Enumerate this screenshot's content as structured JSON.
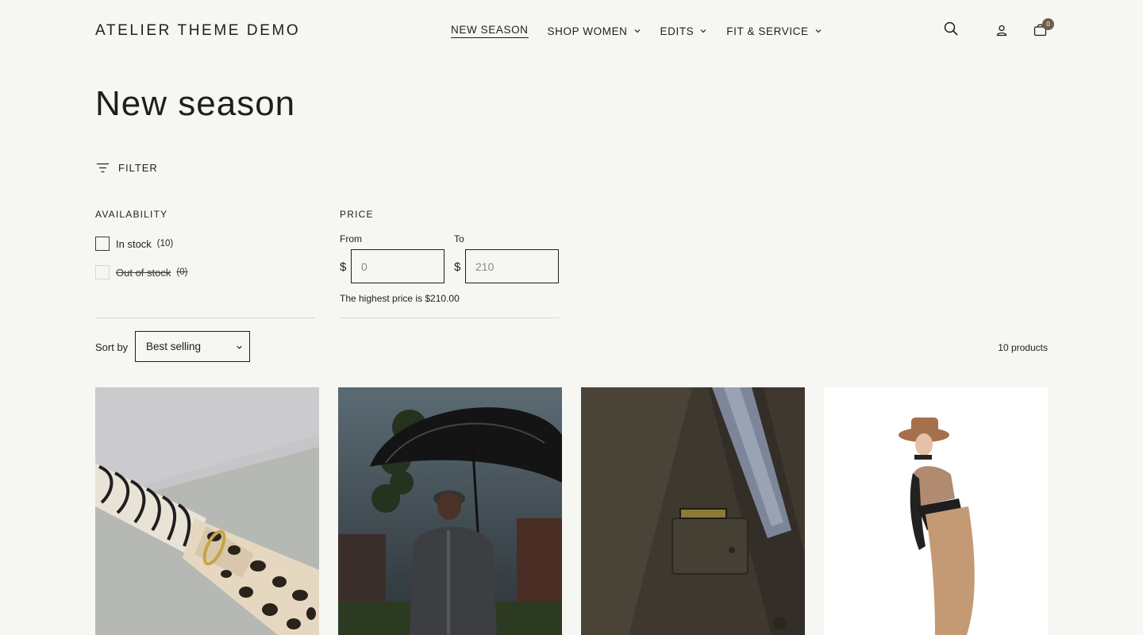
{
  "store": {
    "logo": "ATELIER THEME DEMO"
  },
  "nav": {
    "items": [
      {
        "label": "NEW SEASON",
        "active": true,
        "dropdown": false
      },
      {
        "label": "SHOP WOMEN",
        "active": false,
        "dropdown": true
      },
      {
        "label": "EDITS",
        "active": false,
        "dropdown": true
      },
      {
        "label": "FIT & SERVICE",
        "active": false,
        "dropdown": true
      }
    ]
  },
  "header_icons": {
    "search": "search-icon",
    "account": "account-icon",
    "cart": "cart-icon",
    "cart_count": "0"
  },
  "page": {
    "title": "New season"
  },
  "filter": {
    "toggle_label": "FILTER",
    "availability": {
      "title": "AVAILABILITY",
      "options": [
        {
          "label": "In stock",
          "count": "(10)",
          "disabled": false
        },
        {
          "label": "Out of stock",
          "count": "(0)",
          "disabled": true
        }
      ]
    },
    "price": {
      "title": "PRICE",
      "from_label": "From",
      "to_label": "To",
      "currency": "$",
      "from_placeholder": "0",
      "to_placeholder": "210",
      "note": "The highest price is $210.00"
    }
  },
  "sort": {
    "label": "Sort by",
    "selected": "Best selling"
  },
  "results": {
    "count_label": "10 products"
  },
  "products": [
    {
      "image": "zebra-leopard-scarf-image"
    },
    {
      "image": "man-with-umbrella-image"
    },
    {
      "image": "jacket-pocket-badge-image"
    },
    {
      "image": "woman-in-hat-image"
    }
  ],
  "colors": {
    "background": "#f6f6f2",
    "text": "#1e1e1e",
    "badge": "#6b5d4e"
  }
}
